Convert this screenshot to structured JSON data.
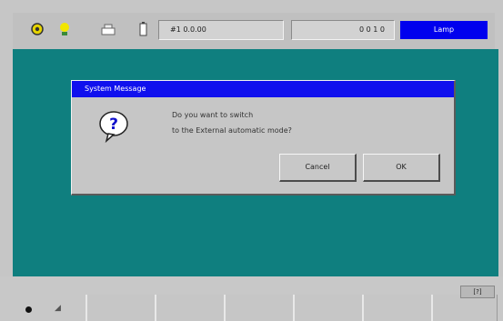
{
  "toolbar": {
    "field1": "#1  0.0.00",
    "field2": "0 0 1 0",
    "mode_label": "Lamp"
  },
  "dialog": {
    "title": "System Message",
    "line1": "Do you want to switch",
    "line2": "to the External automatic mode?",
    "cancel_label": "Cancel",
    "ok_label": "OK"
  },
  "footer": {
    "badge": "[?]"
  },
  "colors": {
    "workarea": "#0f7f7f",
    "titlebar": "#1010ee",
    "mode_box": "#0000ee",
    "panel": "#c6c6c6"
  },
  "icons": [
    "gear-icon",
    "lamp-icon",
    "printer-icon",
    "battery-icon",
    "question-bubble-icon"
  ]
}
